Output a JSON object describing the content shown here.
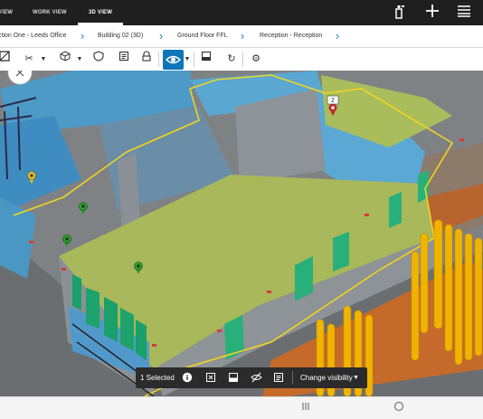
{
  "topbar": {
    "tabs": [
      {
        "label": "VIEW"
      },
      {
        "label": "WORK VIEW"
      },
      {
        "label": "3D VIEW"
      }
    ],
    "icons": [
      "device-icon",
      "plus-icon",
      "menu-icon"
    ]
  },
  "breadcrumb": {
    "items": [
      {
        "label": "ction One - Leeds Office"
      },
      {
        "label": "Building 02 (3D)"
      },
      {
        "label": "Ground Floor FFL"
      },
      {
        "label": "Reception - Reception"
      }
    ]
  },
  "toolbar": {
    "icons": [
      "section-box-icon",
      "cut-icon",
      "cube-icon",
      "shield-icon",
      "clipboard-icon",
      "lock-icon",
      "eye-icon",
      "layers-icon",
      "refresh-icon",
      "settings-icon"
    ]
  },
  "viewport": {
    "pins": [
      {
        "label": "2",
        "color": "#c0282d"
      },
      {
        "label": "",
        "color": "#e0c030"
      },
      {
        "label": "",
        "color": "#2e9a2e"
      },
      {
        "label": "",
        "color": "#2e9a2e"
      },
      {
        "label": "",
        "color": "#2e9a2e"
      }
    ]
  },
  "selection_bar": {
    "count_label": "1 Selected",
    "action_label": "Change visibility"
  },
  "colors": {
    "topbar": "#1f1f1f",
    "accent": "#0f75b9",
    "floor": "#a8b85a",
    "wall": "#5aaad6"
  }
}
